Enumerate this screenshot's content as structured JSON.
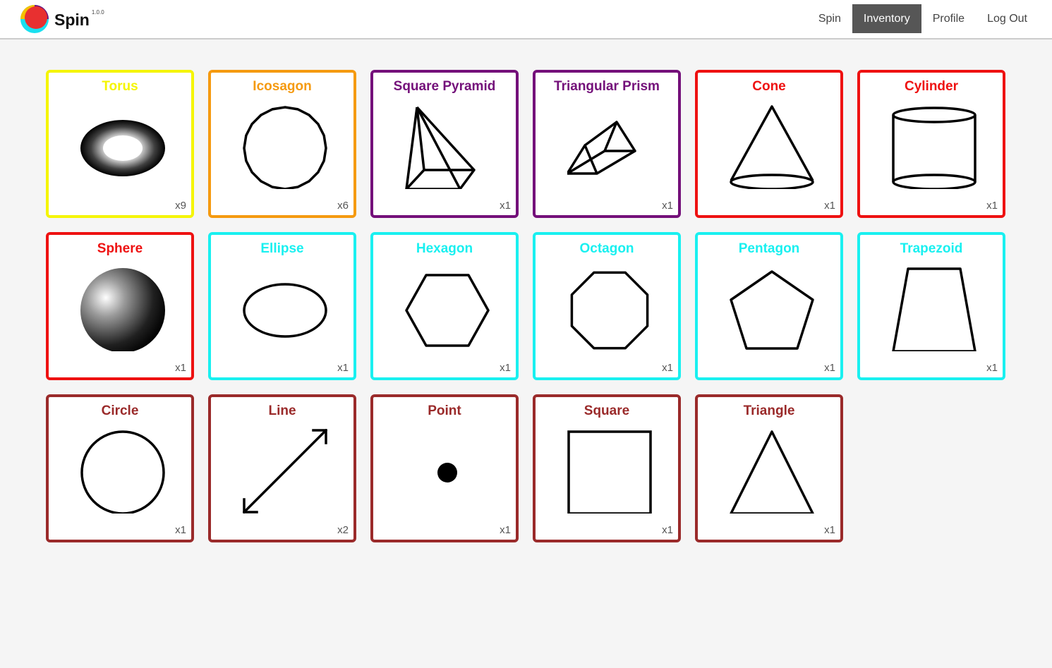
{
  "app": {
    "name": "Spin",
    "version": "1.0.0"
  },
  "nav": [
    {
      "label": "Spin",
      "active": false
    },
    {
      "label": "Inventory",
      "active": true
    },
    {
      "label": "Profile",
      "active": false
    },
    {
      "label": "Log Out",
      "active": false
    }
  ],
  "items": [
    {
      "name": "Torus",
      "count": "x9",
      "color": "#f5f500",
      "icon": "torus-icon"
    },
    {
      "name": "Icosagon",
      "count": "x6",
      "color": "#f59a10",
      "icon": "icosagon-icon"
    },
    {
      "name": "Square Pyramid",
      "count": "x1",
      "color": "#74107a",
      "icon": "square-pyramid-icon"
    },
    {
      "name": "Triangular Prism",
      "count": "x1",
      "color": "#74107a",
      "icon": "triangular-prism-icon"
    },
    {
      "name": "Cone",
      "count": "x1",
      "color": "#ee1111",
      "icon": "cone-icon"
    },
    {
      "name": "Cylinder",
      "count": "x1",
      "color": "#ee1111",
      "icon": "cylinder-icon"
    },
    {
      "name": "Sphere",
      "count": "x1",
      "color": "#ee1111",
      "icon": "sphere-icon"
    },
    {
      "name": "Ellipse",
      "count": "x1",
      "color": "#19f0f0",
      "icon": "ellipse-icon"
    },
    {
      "name": "Hexagon",
      "count": "x1",
      "color": "#19f0f0",
      "icon": "hexagon-icon"
    },
    {
      "name": "Octagon",
      "count": "x1",
      "color": "#19f0f0",
      "icon": "octagon-icon"
    },
    {
      "name": "Pentagon",
      "count": "x1",
      "color": "#19f0f0",
      "icon": "pentagon-icon"
    },
    {
      "name": "Trapezoid",
      "count": "x1",
      "color": "#19f0f0",
      "icon": "trapezoid-icon"
    },
    {
      "name": "Circle",
      "count": "x1",
      "color": "#9a2a2a",
      "icon": "circle-icon"
    },
    {
      "name": "Line",
      "count": "x2",
      "color": "#9a2a2a",
      "icon": "line-icon"
    },
    {
      "name": "Point",
      "count": "x1",
      "color": "#9a2a2a",
      "icon": "point-icon"
    },
    {
      "name": "Square",
      "count": "x1",
      "color": "#9a2a2a",
      "icon": "square-icon"
    },
    {
      "name": "Triangle",
      "count": "x1",
      "color": "#9a2a2a",
      "icon": "triangle-icon"
    }
  ]
}
